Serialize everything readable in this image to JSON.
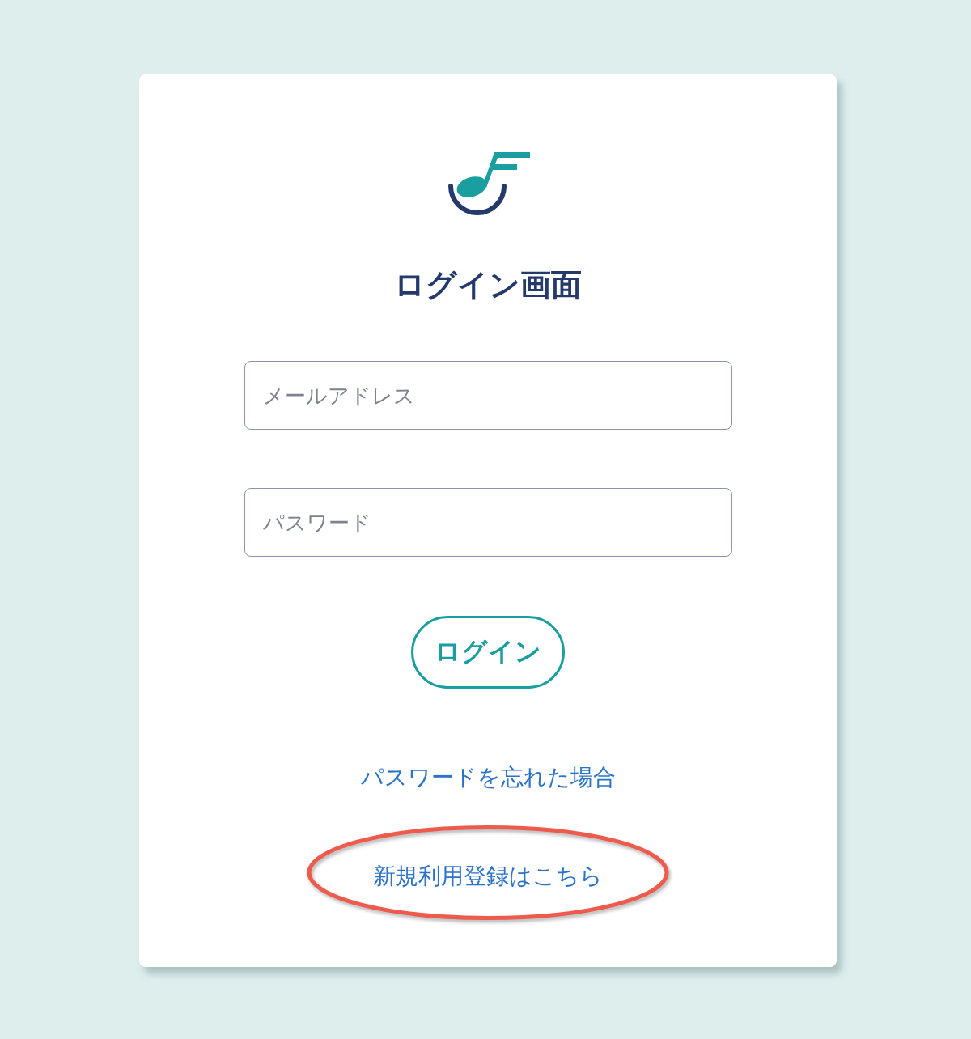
{
  "title": "ログイン画面",
  "fields": [
    {
      "placeholder": "メールアドレス"
    },
    {
      "placeholder": "パスワード"
    }
  ],
  "login_button": "ログイン",
  "links": [
    {
      "label": "パスワードを忘れた場合",
      "highlighted": false
    },
    {
      "label": "新規利用登録はこちら",
      "highlighted": true
    }
  ]
}
